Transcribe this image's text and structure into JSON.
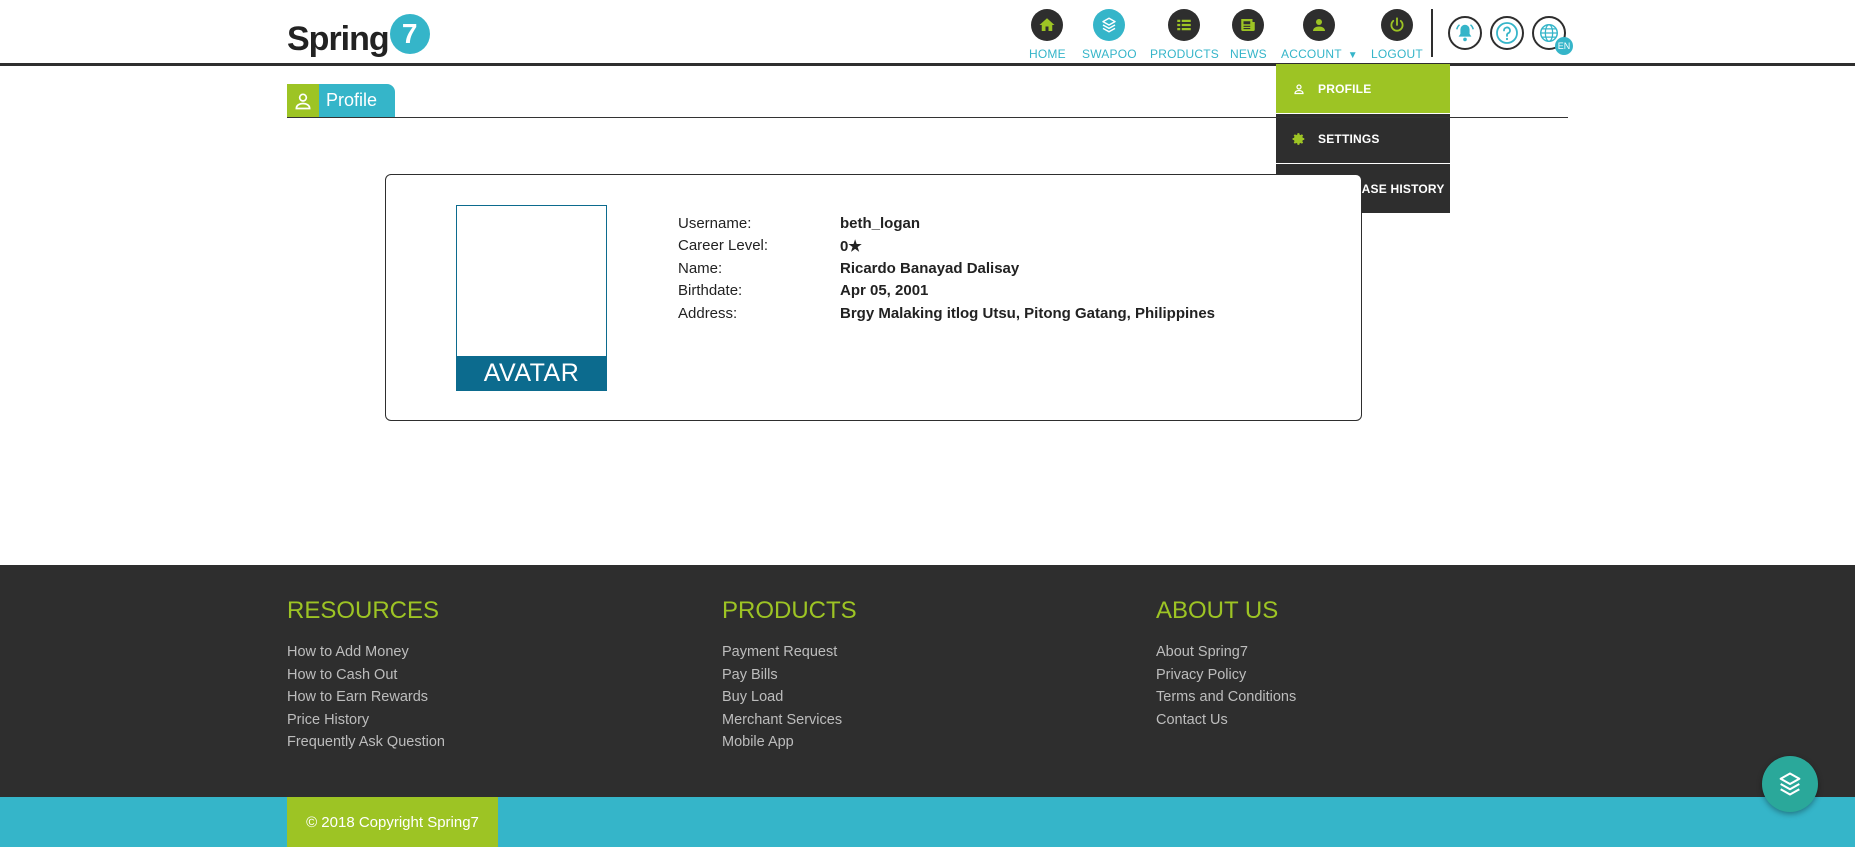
{
  "brand": {
    "logo_text": "Spring",
    "logo_number": "7"
  },
  "nav": [
    {
      "label": "HOME",
      "icon": "home-icon"
    },
    {
      "label": "SWAPOO",
      "icon": "swapoo-icon"
    },
    {
      "label": "PRODUCTS",
      "icon": "list-icon"
    },
    {
      "label": "NEWS",
      "icon": "newspaper-icon"
    },
    {
      "label": "ACCOUNT",
      "icon": "person-icon"
    },
    {
      "label": "LOGOUT",
      "icon": "power-icon"
    }
  ],
  "header_tools": {
    "language_badge": "EN"
  },
  "account_menu": [
    {
      "label": "PROFILE",
      "icon": "person-icon",
      "active": true
    },
    {
      "label": "SETTINGS",
      "icon": "gear-icon",
      "active": false
    },
    {
      "label": "PURCHASE HISTORY",
      "icon": "cart-icon",
      "active": false
    }
  ],
  "page": {
    "tab_label": "Profile"
  },
  "profile": {
    "avatar_label": "AVATAR",
    "fields": [
      {
        "label": "Username:",
        "value": "beth_logan"
      },
      {
        "label": "Career Level:",
        "value": "0★"
      },
      {
        "label": "Name:",
        "value": "Ricardo Banayad Dalisay"
      },
      {
        "label": "Birthdate:",
        "value": "Apr 05, 2001"
      },
      {
        "label": "Address:",
        "value": "Brgy Malaking itlog Utsu, Pitong Gatang, Philippines"
      }
    ]
  },
  "footer": {
    "columns": [
      {
        "title": "RESOURCES",
        "links": [
          "How to Add Money",
          "How to Cash Out",
          "How to Earn Rewards",
          "Price History",
          "Frequently Ask Question"
        ]
      },
      {
        "title": "PRODUCTS",
        "links": [
          "Payment Request",
          "Pay Bills",
          "Buy Load",
          "Merchant Services",
          "Mobile App"
        ]
      },
      {
        "title": "ABOUT US",
        "links": [
          "About Spring7",
          "Privacy Policy",
          "Terms and Conditions",
          "Contact Us"
        ]
      }
    ],
    "copyright": "© 2018 Copyright Spring7"
  },
  "colors": {
    "green": "#9dc424",
    "teal": "#35b5c9",
    "dark": "#2e2e2e",
    "avatar_blue": "#0c6b8e",
    "fab": "#2aa89a"
  }
}
